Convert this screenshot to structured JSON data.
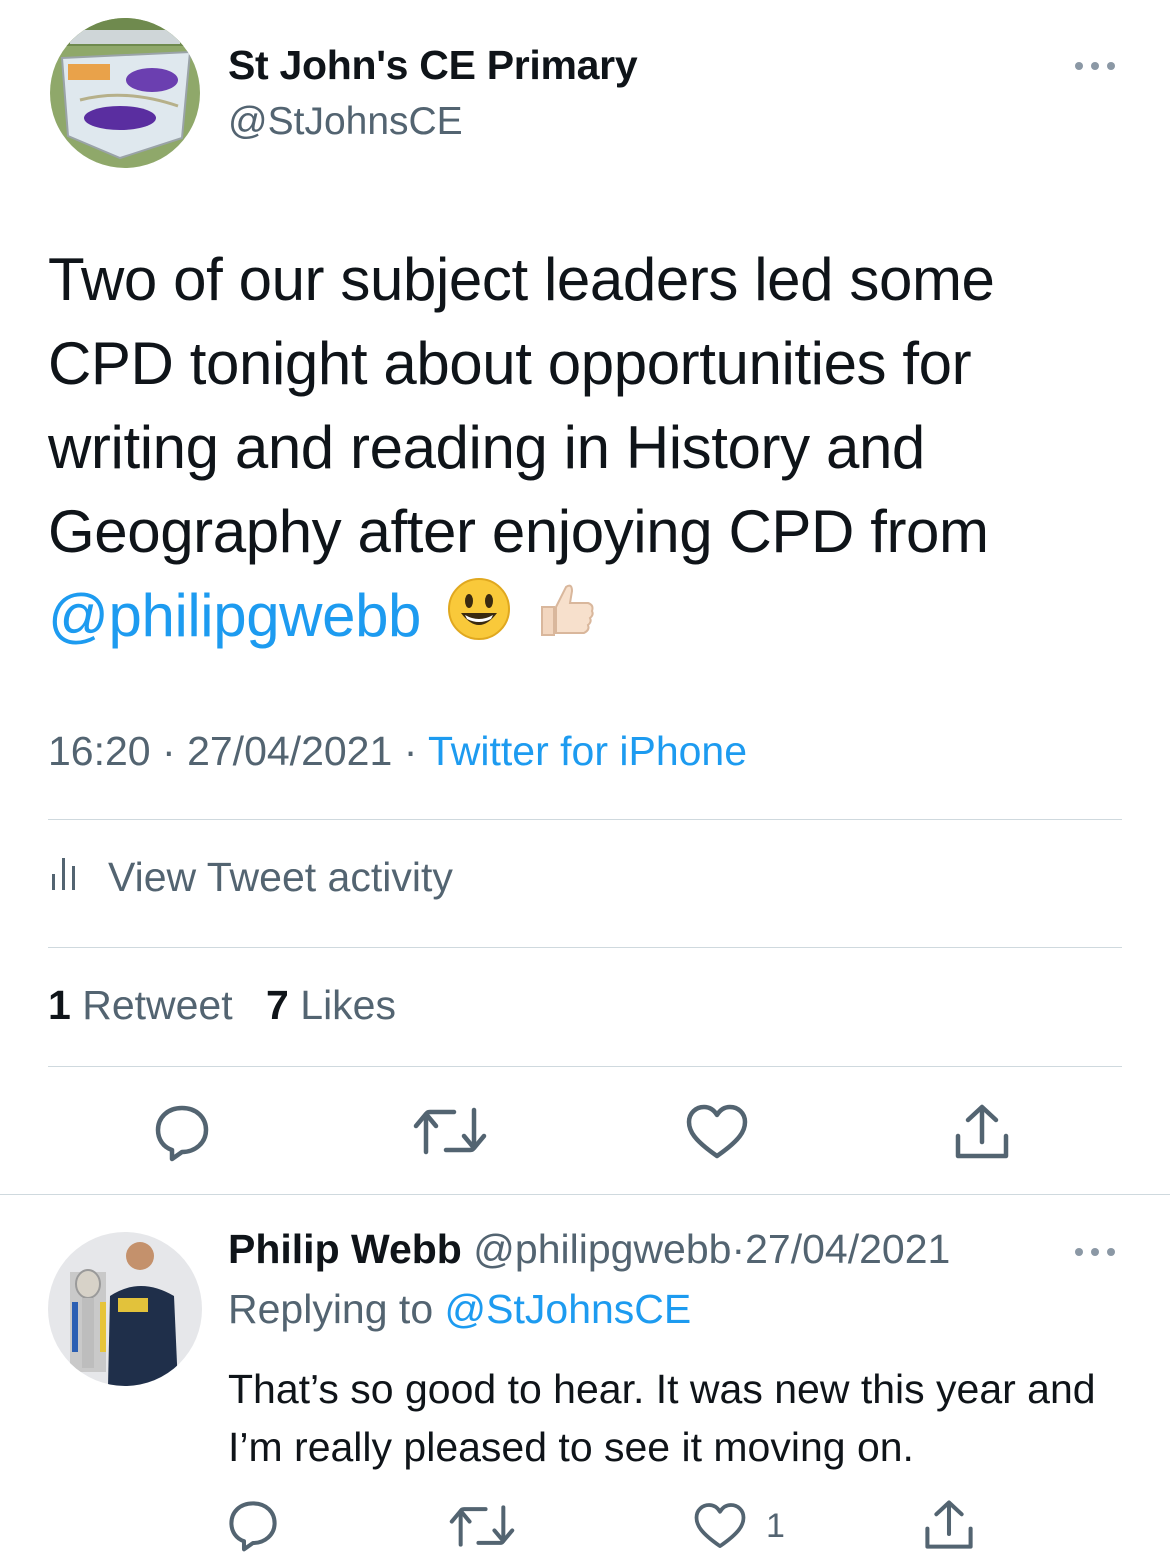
{
  "tweet": {
    "author_name": "St John's CE Primary",
    "author_handle": "@StJohnsCE",
    "text_before_mention": "Two of our subject leaders led some CPD tonight about opportunities for writing and reading in History and Geography after enjoying CPD from",
    "mention": "@philipgwebb",
    "emojis": [
      "smiley-face-icon",
      "thumbs-up-icon"
    ],
    "time": "16:20",
    "date": "27/04/2021",
    "source": "Twitter for iPhone",
    "separator": "·",
    "view_activity_label": "View Tweet activity",
    "retweet_count": "1",
    "retweet_label": "Retweet",
    "like_count": "7",
    "like_label": "Likes"
  },
  "reply": {
    "author_name": "Philip Webb",
    "author_handle": "@philipgwebb",
    "date": "27/04/2021",
    "separator": "·",
    "replying_to_label": "Replying to",
    "replying_to_handle": "@StJohnsCE",
    "text": "That’s so good to hear. It was new this year and I’m really pleased to see it moving on.",
    "like_count": "1"
  },
  "colors": {
    "accent": "#1d9bf0",
    "secondary_text": "#536471",
    "divider": "#cfd9de"
  }
}
